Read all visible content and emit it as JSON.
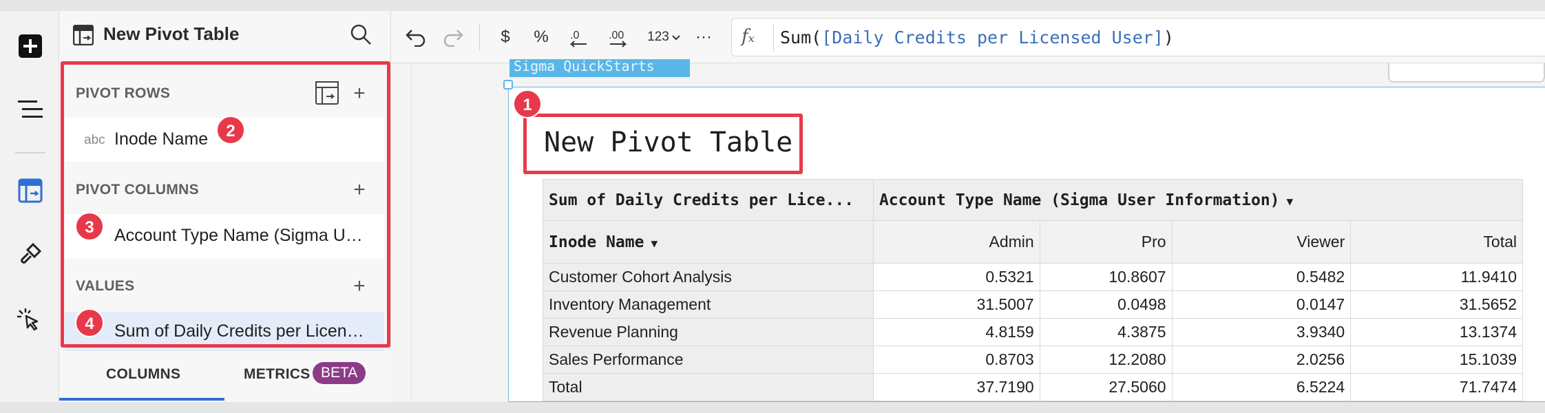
{
  "panel": {
    "title": "New Pivot Table",
    "sections": {
      "rows_label": "PIVOT ROWS",
      "row_field_type": "abc",
      "row_field": "Inode Name",
      "columns_label": "PIVOT COLUMNS",
      "column_field": "Account Type Name (Sigma U…",
      "values_label": "VALUES",
      "value_field": "Sum of Daily Credits per Licen…"
    },
    "tabs": {
      "columns": "COLUMNS",
      "metrics": "METRICS",
      "beta": "BETA"
    }
  },
  "badges": {
    "b1": "1",
    "b2": "2",
    "b3": "3",
    "b4": "4"
  },
  "toolbar": {
    "currency": "$",
    "percent": "%",
    "number_format": "123",
    "more": "···",
    "fx": "fₓ",
    "formula_prefix": "Sum(",
    "formula_ref": "[Daily Credits per Licensed User]",
    "formula_suffix": ")"
  },
  "canvas": {
    "selection_tag": "Sigma QuickStarts",
    "element_title": "New Pivot Table"
  },
  "table": {
    "value_header": "Sum of Daily Credits per Lice...",
    "column_group_header": "Account Type Name (Sigma User Information)",
    "row_header": "Inode Name",
    "columns": [
      "Admin",
      "Pro",
      "Viewer",
      "Total"
    ],
    "rows": [
      {
        "name": "Customer Cohort Analysis",
        "values": [
          "0.5321",
          "10.8607",
          "0.5482",
          "11.9410"
        ]
      },
      {
        "name": "Inventory Management",
        "values": [
          "31.5007",
          "0.0498",
          "0.0147",
          "31.5652"
        ]
      },
      {
        "name": "Revenue Planning",
        "values": [
          "4.8159",
          "4.3875",
          "3.9340",
          "13.1374"
        ]
      },
      {
        "name": "Sales Performance",
        "values": [
          "0.8703",
          "12.2080",
          "2.0256",
          "15.1039"
        ]
      },
      {
        "name": "Total",
        "values": [
          "37.7190",
          "27.5060",
          "6.5224",
          "71.7474"
        ]
      }
    ]
  },
  "colors": {
    "annotation_red": "#e8394a",
    "accent_blue": "#2f6ed8",
    "beta_purple": "#8c3b86"
  }
}
